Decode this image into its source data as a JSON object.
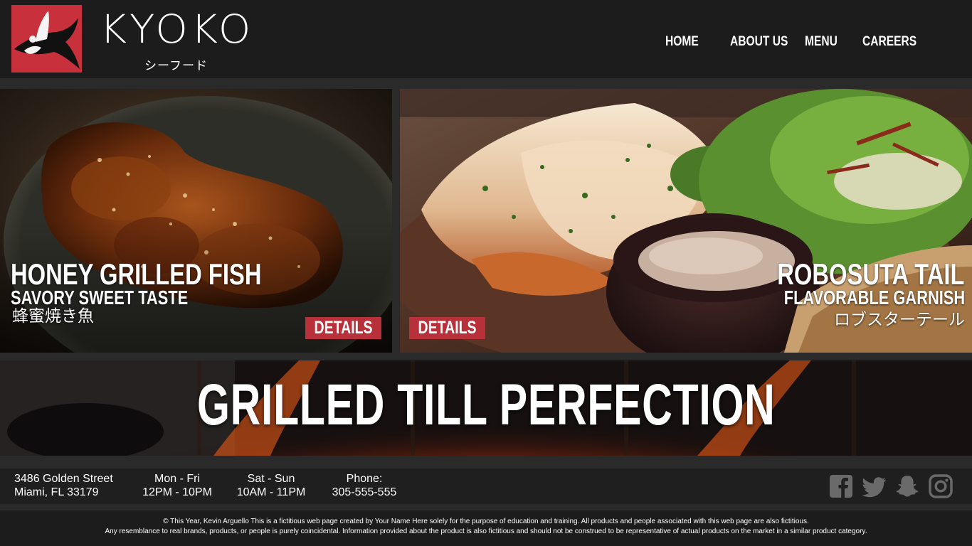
{
  "header": {
    "brand": "KYOKO",
    "brand_sub": "シーフード",
    "nav": [
      "HOME",
      "ABOUT US",
      "MENU",
      "CAREERS"
    ]
  },
  "dishes": [
    {
      "title": "HONEY GRILLED FISH",
      "subtitle": "SAVORY SWEET TASTE",
      "japanese": "蜂蜜焼き魚",
      "details_label": "DETAILS"
    },
    {
      "title": "ROBOSUTA TAIL",
      "subtitle": "FLAVORABLE GARNISH",
      "japanese": "ロブスターテール",
      "details_label": "DETAILS"
    }
  ],
  "banner": {
    "text": "GRILLED TILL PERFECTION"
  },
  "info": {
    "address_line1": "3486  Golden Street",
    "address_line2": "Miami, FL 33179",
    "weekday_label": "Mon - Fri",
    "weekday_hours": "12PM - 10PM",
    "weekend_label": "Sat - Sun",
    "weekend_hours": "10AM - 11PM",
    "phone_label": "Phone:",
    "phone": "305-555-555",
    "social_icons": [
      "facebook-icon",
      "twitter-icon",
      "snapchat-icon",
      "instagram-icon"
    ]
  },
  "footer": {
    "line1": "© This Year, Kevin Arguello This is a fictitious web page created by Your Name Here solely for the  purpose of education and training. All products and people associated with this web page are also fictitious.",
    "line2": "Any resemblance to real brands, products, or people is purely coincidental. Information provided about the product is also fictitious and should not be construed to be representative of actual products on the market in a similar product category."
  },
  "colors": {
    "accent": "#b8303a",
    "logo_bg": "#c8313c",
    "header_bg": "#1c1c1c",
    "icon_gray": "#6a6a6a"
  }
}
